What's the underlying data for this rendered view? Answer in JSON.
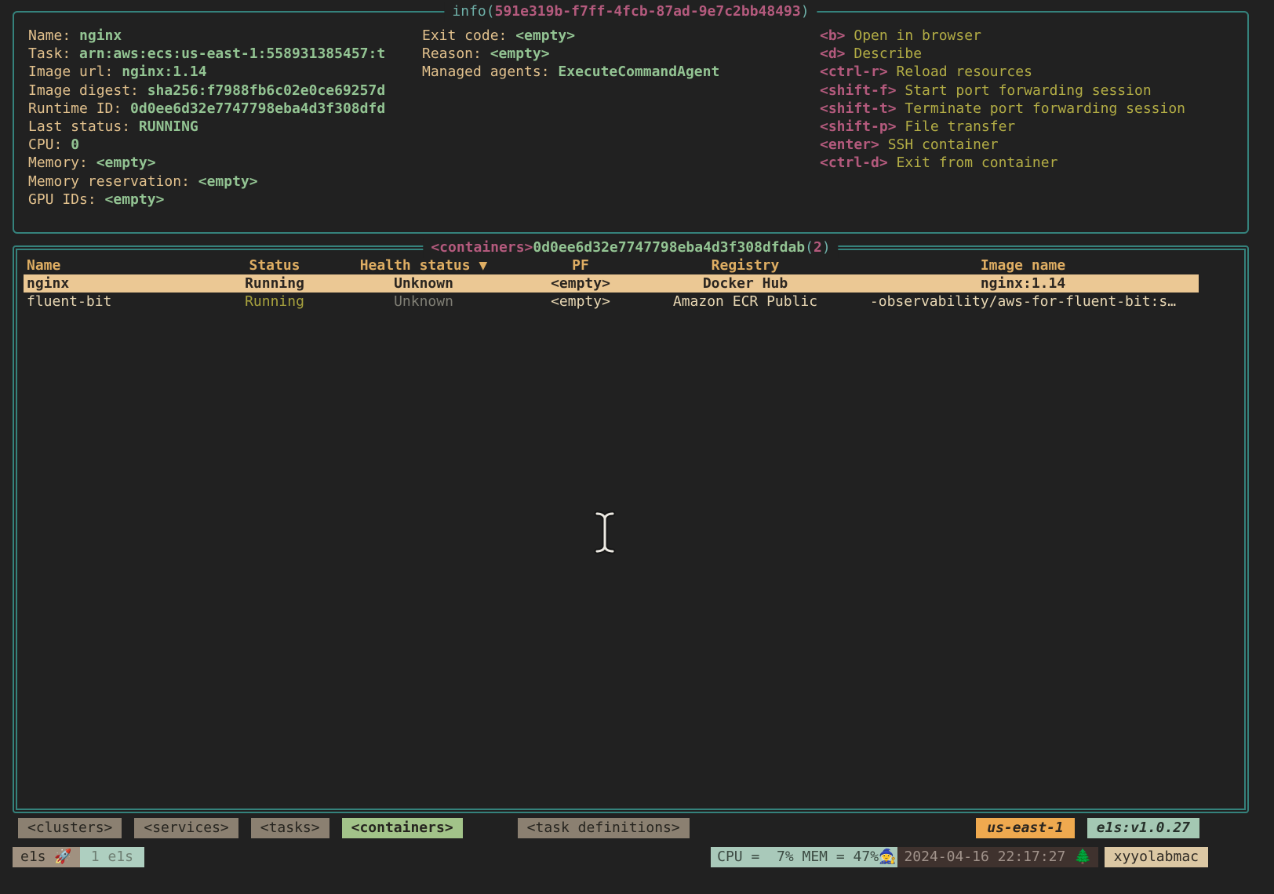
{
  "colors": {
    "background": "#212121",
    "border_teal": "#35827c",
    "accent_pink": "#b45a7d",
    "accent_green": "#93c493",
    "label_tan": "#e2c18d",
    "header_orange": "#dfae63",
    "shortcut_olive": "#b3ad45",
    "selected_row_bg": "#ebc894",
    "nav_btn_bg": "#8b8071",
    "nav_active_bg": "#a2c389",
    "region_bg": "#efa94f",
    "version_bg": "#a4c8b3"
  },
  "info_panel": {
    "title_prefix": "info(",
    "title_id": "591e319b-f7ff-4fcb-87ad-9e7c2bb48493",
    "title_suffix": ")",
    "fields_left": [
      {
        "label": "Name: ",
        "value": "nginx"
      },
      {
        "label": "Task: ",
        "value": "arn:aws:ecs:us-east-1:558931385457:t"
      },
      {
        "label": "Image url: ",
        "value": "nginx:1.14"
      },
      {
        "label": "Image digest: ",
        "value": "sha256:f7988fb6c02e0ce69257d"
      },
      {
        "label": "Runtime ID: ",
        "value": "0d0ee6d32e7747798eba4d3f308dfd"
      },
      {
        "label": "Last status: ",
        "value": "RUNNING"
      },
      {
        "label": "CPU: ",
        "value": "0"
      },
      {
        "label": "Memory: ",
        "value": "<empty>"
      },
      {
        "label": "Memory reservation: ",
        "value": "<empty>"
      },
      {
        "label": "GPU IDs: ",
        "value": "<empty>"
      }
    ],
    "fields_middle": [
      {
        "label": "Exit code: ",
        "value": "<empty>"
      },
      {
        "label": "Reason: ",
        "value": "<empty>"
      },
      {
        "label": "Managed agents: ",
        "value": "ExecuteCommandAgent"
      }
    ],
    "shortcuts": [
      {
        "key": "<b>",
        "action": " Open in browser"
      },
      {
        "key": "<d>",
        "action": " Describe"
      },
      {
        "key": "<ctrl-r>",
        "action": " Reload resources"
      },
      {
        "key": "<shift-f>",
        "action": " Start port forwarding session"
      },
      {
        "key": "<shift-t>",
        "action": " Terminate port forwarding session"
      },
      {
        "key": "<shift-p>",
        "action": " File transfer"
      },
      {
        "key": "<enter>",
        "action": " SSH container"
      },
      {
        "key": "<ctrl-d>",
        "action": " Exit from container"
      }
    ]
  },
  "containers_panel": {
    "title_tag": "<containers>",
    "title_id": "0d0ee6d32e7747798eba4d3f308dfdab",
    "title_open": "(",
    "title_count": "2",
    "title_close": ")",
    "columns": {
      "name": "Name",
      "status": "Status",
      "health": "Health status ▼",
      "pf": "PF",
      "registry": "Registry",
      "image": "Image name"
    },
    "rows": [
      {
        "name": "nginx",
        "status": "Running",
        "health": "Unknown",
        "pf": "<empty>",
        "registry": "Docker Hub",
        "image": "nginx:1.14"
      },
      {
        "name": "fluent-bit",
        "status": "Running",
        "health": "Unknown",
        "pf": "<empty>",
        "registry": "Amazon ECR Public",
        "image": "-observability/aws-for-fluent-bit:s…"
      }
    ]
  },
  "nav": {
    "clusters": "<clusters>",
    "services": "<services>",
    "tasks": "<tasks>",
    "containers": "<containers>",
    "task_definitions": "<task definitions>",
    "region": "us-east-1",
    "version": "e1s:v1.0.27"
  },
  "statusbar": {
    "app": "e1s ",
    "rocket_icon": "🚀",
    "count": "1 e1s",
    "cpu_mem": "CPU =  7% MEM = 47%",
    "wizard_icon": "🧙",
    "datetime": "2024-04-16 22:17:27 ",
    "tree_icon": "🌲",
    "host": "xyyolabmac"
  }
}
